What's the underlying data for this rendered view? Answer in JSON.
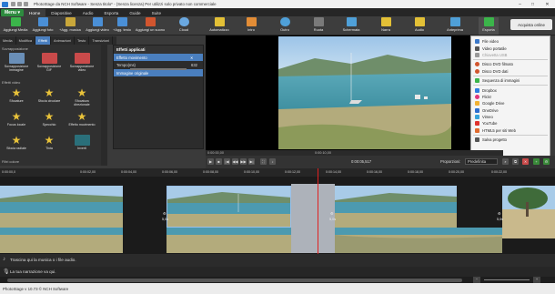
{
  "window": {
    "title": "PhotoStage da NCH Software - Senza titolo* - (Senza licenza) Per utilizzi solo privato non commerciale",
    "minimize": "–",
    "maximize": "□",
    "close": "✕"
  },
  "menubar": {
    "menu_label": "Menu",
    "tabs": [
      "Home",
      "Diapositive",
      "Audio",
      "Esporta",
      "Guide",
      "Suite"
    ]
  },
  "ribbon": {
    "buttons": [
      {
        "label": "Aggiungi Media",
        "color": "#3bb54a"
      },
      {
        "label": "Aggiungi foto",
        "color": "#4a8fd6"
      },
      {
        "label": "+Agg. musica",
        "color": "#c9a73a"
      },
      {
        "label": "Aggiungi video",
        "color": "#4a8fd6"
      },
      {
        "label": "+Agg. testo",
        "color": "#4a8fd6"
      },
      {
        "label": "Aggiungi un suono",
        "color": "#d2552e"
      },
      {
        "label": "Cloud",
        "color": "#6aa8e0"
      },
      {
        "label": "Automatizzo",
        "color": "#e3c036"
      },
      {
        "label": "Intro",
        "color": "#e38d36"
      },
      {
        "label": "Outro",
        "color": "#4fa0d8"
      },
      {
        "label": "Ruota",
        "color": "#7a7a7a"
      },
      {
        "label": "Schermata",
        "color": "#4fa0d8"
      },
      {
        "label": "Narra",
        "color": "#e3c036"
      },
      {
        "label": "Audio",
        "color": "#e3c036"
      },
      {
        "label": "Anteprima",
        "color": "#4fa0d8"
      },
      {
        "label": "Esporta",
        "color": "#3bb54a"
      }
    ],
    "buy_label": "Acquista online"
  },
  "left_tabs": [
    "Media",
    "Modifica",
    "Effetti",
    "Animazioni",
    "Testo",
    "Transizioni"
  ],
  "left_panel": {
    "section_transitions": "Sovrapposizione",
    "section_video": "Effetti video",
    "section_color": "Filtri colore",
    "effects_row1": [
      "Sovrapposizione immagine",
      "Sovrapposizione GIF",
      "Sovrapposizione video"
    ],
    "effects_rows": [
      [
        "Sfocature",
        "Sfocia circolare",
        "Sfocatura direzionale"
      ],
      [
        "Focus locale",
        "Specchio",
        "Effetto movimento"
      ],
      [
        "Sfocia radiale",
        "Tinta",
        "Inverti"
      ]
    ]
  },
  "effects_panel": {
    "header": "Effetti applicati",
    "selected_effect": "Effetto movimento",
    "param_label": "Tempo(ms)",
    "param_value": "632",
    "original_image": "Immagine originale"
  },
  "export_menu": {
    "items": [
      {
        "label": "File video",
        "color": "#3b78c9",
        "disabled": false
      },
      {
        "label": "Video portatile",
        "color": "#555555",
        "disabled": false
      },
      {
        "label": "Chiavetta USB",
        "color": "#999999",
        "disabled": true
      },
      {
        "sep": true
      },
      {
        "label": "Disco DVD filmato",
        "color": "#d2552e",
        "disabled": false
      },
      {
        "label": "Disco DVD dati",
        "color": "#d2552e",
        "disabled": false
      },
      {
        "sep": true
      },
      {
        "label": "Sequenza di immagini",
        "color": "#3bb54a",
        "disabled": false
      },
      {
        "sep": true
      },
      {
        "label": "Dropbox",
        "color": "#2d7ee0",
        "disabled": false
      },
      {
        "label": "Flickr",
        "color": "#e0357a",
        "disabled": false
      },
      {
        "label": "Google Drive",
        "color": "#f2b233",
        "disabled": false
      },
      {
        "label": "OneDrive",
        "color": "#2d6fd0",
        "disabled": false
      },
      {
        "label": "Vimeo",
        "color": "#36a3d9",
        "disabled": false
      },
      {
        "label": "YouTube",
        "color": "#e0322d",
        "disabled": false
      },
      {
        "label": "HTML5 per siti Web",
        "color": "#e06a2d",
        "disabled": false
      },
      {
        "sep": true
      },
      {
        "label": "Salva progetto",
        "color": "#555555",
        "disabled": false
      }
    ]
  },
  "preview": {
    "time_left": "0:00:00,00",
    "time_mid": "0:00:10,00",
    "current_time": "0:00:05,517",
    "proportion_label": "Proporzioni:",
    "proportion_value": "Predefinita"
  },
  "timeline": {
    "ticks": [
      "0:00:00,0",
      "0:00:02,00",
      "0:00:04,00",
      "0:00:06,00",
      "0:00:08,00",
      "0:00:10,00",
      "0:00:12,00",
      "0:00:14,00",
      "0:00:16,00",
      "0:00:18,00",
      "0:00:20,00",
      "0:00:22,00"
    ],
    "clip_duration": "5,0s",
    "audio_hint": "Trascina qui la musica o i file audio.",
    "narration_hint": "La tua narrazione va qui."
  },
  "status": {
    "text": "PhotoStage v 10.73 © NCH Software"
  }
}
